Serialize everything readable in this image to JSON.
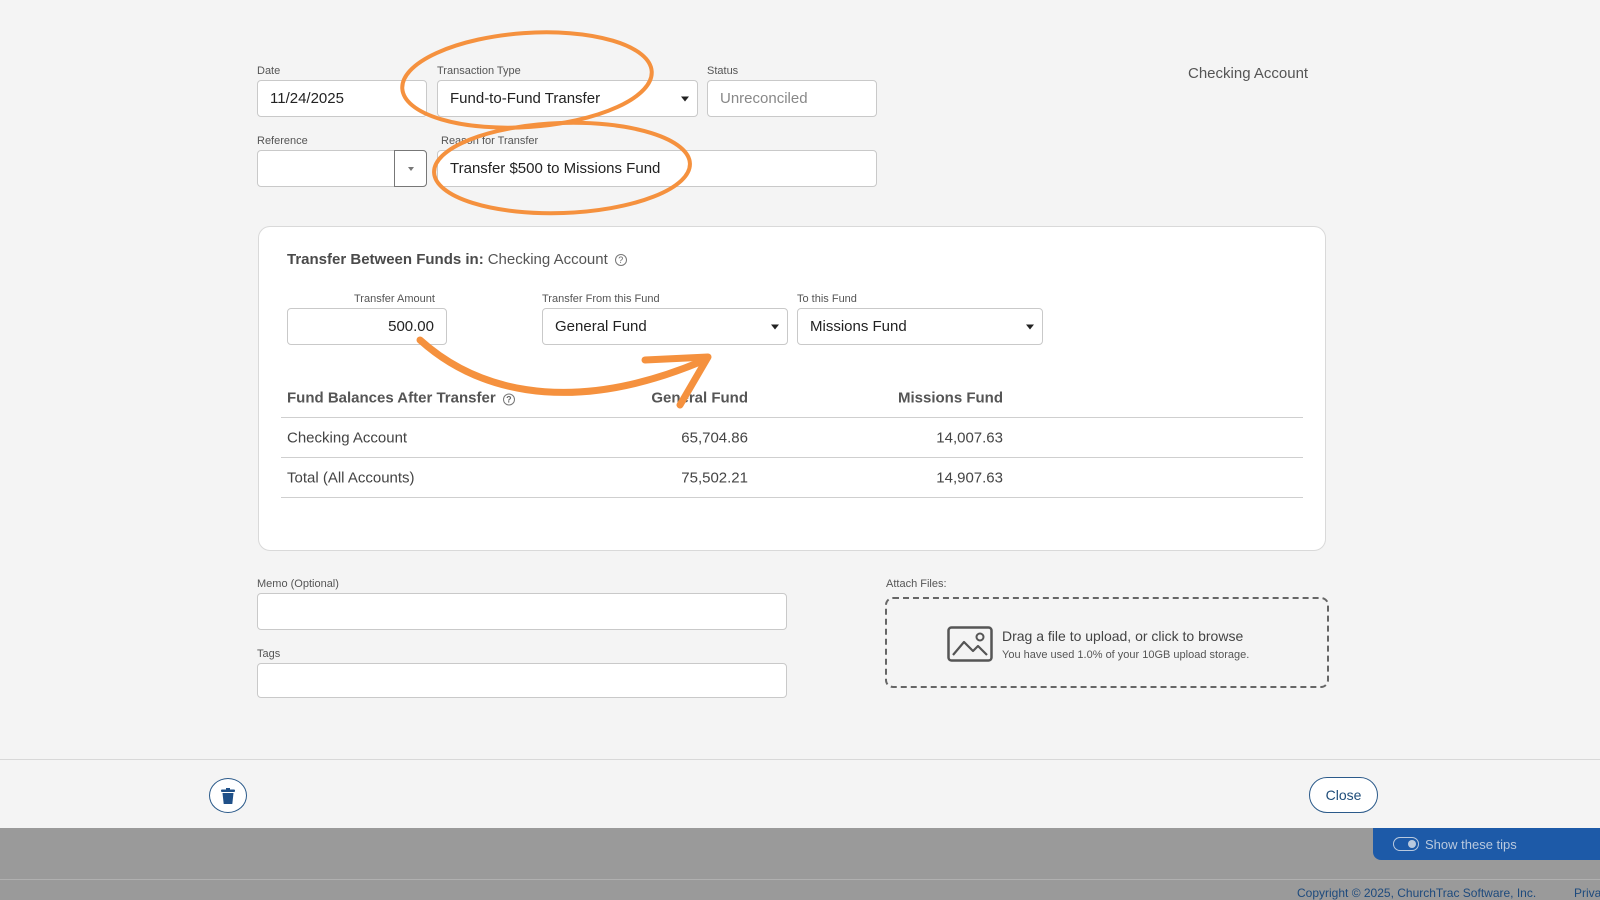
{
  "form": {
    "date": {
      "label": "Date",
      "value": "11/24/2025"
    },
    "transaction_type": {
      "label": "Transaction Type",
      "value": "Fund-to-Fund Transfer"
    },
    "status": {
      "label": "Status",
      "value": "Unreconciled"
    },
    "reference": {
      "label": "Reference",
      "value": ""
    },
    "reason": {
      "label": "Reason for Transfer",
      "value": "Transfer $500 to Missions Fund"
    },
    "account_name": "Checking Account"
  },
  "panel": {
    "title_bold": "Transfer Between Funds in:",
    "title_account": "Checking Account",
    "amount": {
      "label": "Transfer Amount",
      "value": "500.00"
    },
    "from_fund": {
      "label": "Transfer From this Fund",
      "value": "General Fund"
    },
    "to_fund": {
      "label": "To this Fund",
      "value": "Missions Fund"
    },
    "table": {
      "headers": [
        "Fund Balances After Transfer",
        "General Fund",
        "Missions Fund"
      ],
      "rows": [
        [
          "Checking Account",
          "65,704.86",
          "14,007.63"
        ],
        [
          "Total (All Accounts)",
          "75,502.21",
          "14,907.63"
        ]
      ]
    }
  },
  "memo": {
    "label": "Memo (Optional)",
    "value": ""
  },
  "tags": {
    "label": "Tags",
    "value": ""
  },
  "attach": {
    "label": "Attach Files:",
    "main": "Drag a file to upload, or click to browse",
    "sub": "You have used 1.0% of your 10GB upload storage."
  },
  "footer": {
    "close_label": "Close",
    "tips_label": "Show these tips",
    "copyright": "Copyright © 2025, ChurchTrac Software, Inc.",
    "privacy": "Priva"
  },
  "icons": [
    "question-circle-icon",
    "chevron-down-icon",
    "image-icon",
    "trash-icon",
    "toggle-icon"
  ],
  "colors": {
    "annotation": "#f5913e",
    "accent": "#1f4d7a",
    "tips_bg": "#1d5aa8"
  }
}
